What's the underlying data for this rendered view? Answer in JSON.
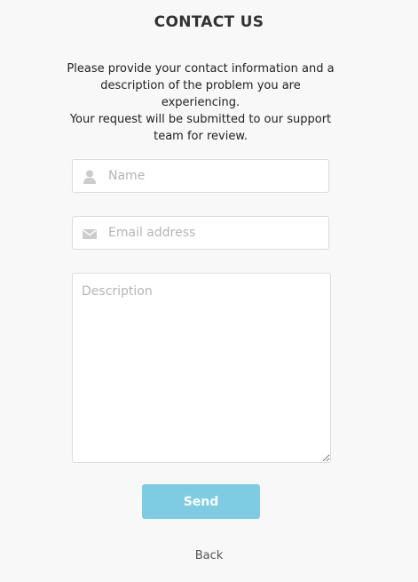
{
  "page": {
    "title": "CONTACT US",
    "intro_line1": "Please provide your contact information and a description of the problem you are experiencing.",
    "intro_line2": "Your request will be submitted to our support team for review."
  },
  "form": {
    "name": {
      "icon": "user-icon",
      "value": "",
      "placeholder": "Name"
    },
    "email": {
      "icon": "envelope-icon",
      "value": "",
      "placeholder": "Email address"
    },
    "description": {
      "value": "",
      "placeholder": "Description"
    },
    "send_label": "Send"
  },
  "footer": {
    "back_label": "Back"
  },
  "colors": {
    "background": "#f8f8f8",
    "accent": "#7ecbe4",
    "border": "#dcdcdc",
    "placeholder": "#b5b5b5",
    "icon": "#cccccc"
  }
}
